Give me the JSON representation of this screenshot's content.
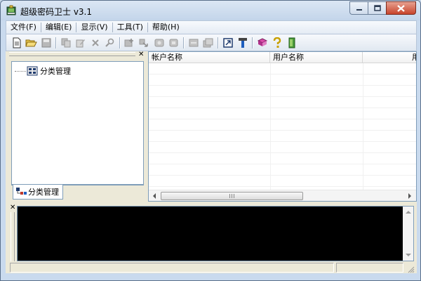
{
  "window": {
    "title": "超级密码卫士 v3.1",
    "icon": "safe-guard-icon"
  },
  "caption_buttons": [
    "minimize-icon",
    "maximize-icon",
    "close-icon"
  ],
  "menu": [
    "文件(F)",
    "编辑(E)",
    "显示(V)",
    "工具(T)",
    "帮助(H)"
  ],
  "toolbar": {
    "groups": [
      [
        "new-doc-icon",
        "open-folder-icon",
        "save-icon"
      ],
      [
        "copy-icon",
        "edit-icon",
        "delete-icon",
        "find-icon"
      ],
      [
        "add-category-icon",
        "move-icon",
        "refresh-icon",
        "paste-icon"
      ],
      [
        "collapse-icon",
        "expand-icon"
      ],
      [
        "export-icon",
        "tools-icon"
      ],
      [
        "book-icon",
        "help-icon",
        "exit-icon"
      ]
    ]
  },
  "tree": {
    "root_label": "分类管理",
    "root_icon": "category-folder-icon"
  },
  "tab": {
    "label": "分类管理",
    "icon": "category-tree-icon"
  },
  "list": {
    "columns": [
      "帐户名称",
      "用户名称",
      "用户"
    ]
  },
  "scrollbar": {
    "grip_glyph": "grip-icon"
  },
  "colors": {
    "console_bg": "#000000",
    "window_frame": "#c9daee",
    "close_button": "#c7442b"
  }
}
